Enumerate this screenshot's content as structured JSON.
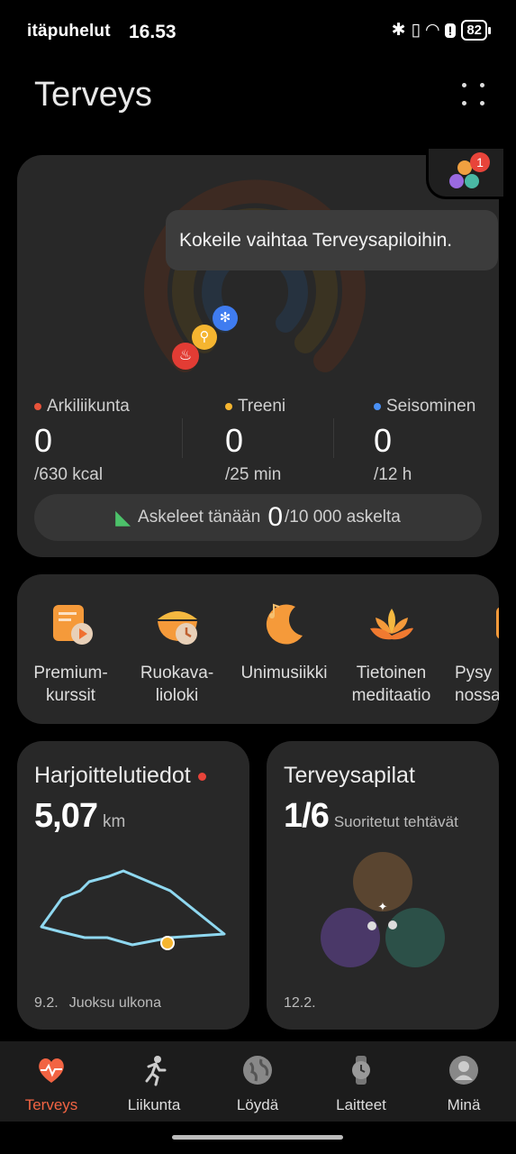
{
  "status_bar": {
    "carrier": "itäpuhelut",
    "time": "16.53",
    "battery": "82"
  },
  "header": {
    "title": "Terveys"
  },
  "activity": {
    "tooltip": "Kokeile vaihtaa Terveysapiloihin.",
    "badge_count": "1",
    "stats": [
      {
        "label": "Arkiliikunta",
        "value": "0",
        "goal": "/630 kcal",
        "color": "#e8533a"
      },
      {
        "label": "Treeni",
        "value": "0",
        "goal": "/25 min",
        "color": "#f5b530"
      },
      {
        "label": "Seisominen",
        "value": "0",
        "goal": "/12 h",
        "color": "#4a90f5"
      }
    ],
    "steps": {
      "prefix": "Askeleet tänään",
      "value": "0",
      "suffix": "/10 000 askelta"
    }
  },
  "services": [
    {
      "label": "Premium-\nkurssit",
      "icon": "course-icon"
    },
    {
      "label": "Ruokava-\nlioloki",
      "icon": "food-diary-icon"
    },
    {
      "label": "Unimusiikki",
      "icon": "sleep-music-icon"
    },
    {
      "label": "Tietoinen\nmeditaatio",
      "icon": "meditation-icon"
    },
    {
      "label": "Pysy\nnossa",
      "icon": "stay-icon"
    }
  ],
  "workout_card": {
    "title": "Harjoittelutiedot",
    "value": "5,07",
    "unit": "km",
    "date": "9.2.",
    "activity": "Juoksu ulkona"
  },
  "clover_card": {
    "title": "Terveysapilat",
    "value": "1/6",
    "unit": "Suoritetut tehtävät",
    "date": "12.2."
  },
  "nav": [
    {
      "label": "Terveys",
      "active": true
    },
    {
      "label": "Liikunta",
      "active": false
    },
    {
      "label": "Löydä",
      "active": false
    },
    {
      "label": "Laitteet",
      "active": false
    },
    {
      "label": "Minä",
      "active": false
    }
  ],
  "colors": {
    "accent": "#f26443",
    "move": "#e8533a",
    "exercise": "#f5b530",
    "stand": "#4a90f5",
    "route": "#8fd8f0"
  }
}
